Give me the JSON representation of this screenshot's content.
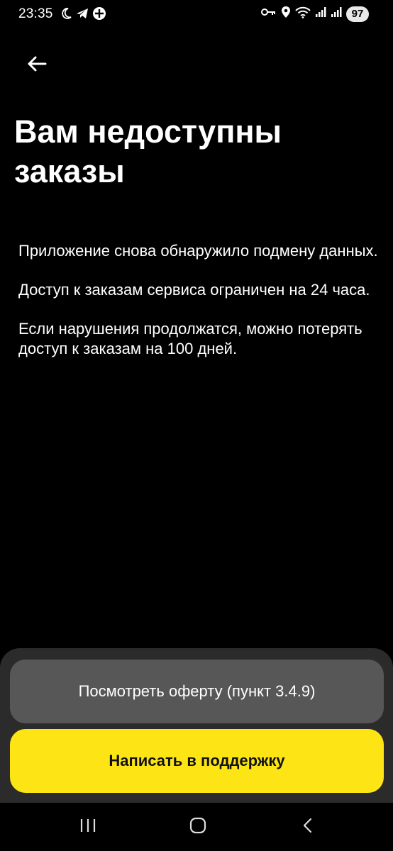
{
  "status_bar": {
    "time": "23:35",
    "battery": "97",
    "left_icons": [
      "moon-icon",
      "telegram-icon",
      "plus-circle-icon"
    ],
    "right_icons": [
      "key-icon",
      "location-icon",
      "wifi-icon",
      "signal-icon",
      "signal-icon"
    ]
  },
  "header": {
    "title": "Вам недоступны заказы"
  },
  "message": {
    "paragraph1": "Приложение снова обнаружило подмену данных.",
    "paragraph2": "Доступ к заказам сервиса ограничен на 24 часа.",
    "paragraph3": "Если нарушения продолжатся, можно потерять доступ к заказам на 100 дней."
  },
  "actions": {
    "offer_label": "Посмотреть оферту (пункт 3.4.9)",
    "support_label": "Написать в поддержку"
  },
  "colors": {
    "background": "#000000",
    "sheet": "#2b2b2b",
    "secondary_button": "#575757",
    "primary_button": "#fde515"
  },
  "nav_bar": {
    "icons": [
      "recent-apps-icon",
      "home-icon",
      "back-icon"
    ]
  }
}
